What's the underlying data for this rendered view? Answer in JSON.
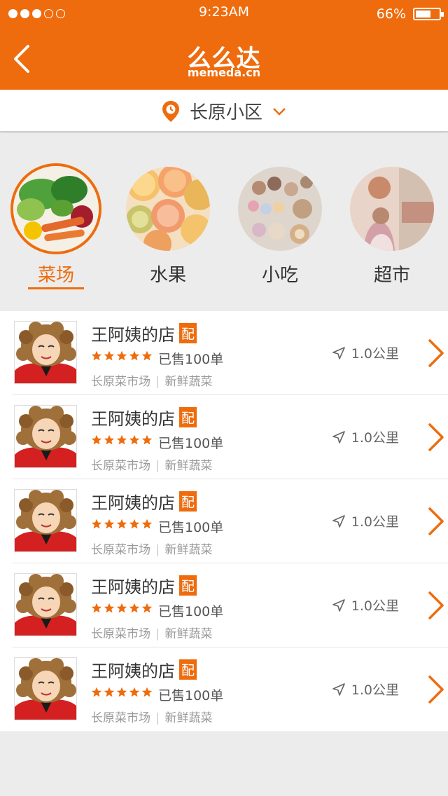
{
  "status_bar": {
    "time": "9:23AM",
    "battery": "66%",
    "battery_level": 0.66,
    "signal_dots": [
      true,
      true,
      true,
      false,
      false
    ]
  },
  "header": {
    "logo_zh": "么么达",
    "logo_en": "memeda.cn"
  },
  "location": {
    "label": "长原小区"
  },
  "colors": {
    "accent": "#ee6c0d"
  },
  "categories": [
    {
      "label": "菜场",
      "active": true
    },
    {
      "label": "水果",
      "active": false
    },
    {
      "label": "小吃",
      "active": false
    },
    {
      "label": "超市",
      "active": false
    }
  ],
  "shops": [
    {
      "name": "王阿姨的店",
      "badge": "配",
      "rating": 5,
      "sold": "已售100单",
      "market": "长原菜市场",
      "separator": "|",
      "tag": "新鲜蔬菜",
      "distance": "1.0公里"
    },
    {
      "name": "王阿姨的店",
      "badge": "配",
      "rating": 5,
      "sold": "已售100单",
      "market": "长原菜市场",
      "separator": "|",
      "tag": "新鲜蔬菜",
      "distance": "1.0公里"
    },
    {
      "name": "王阿姨的店",
      "badge": "配",
      "rating": 5,
      "sold": "已售100单",
      "market": "长原菜市场",
      "separator": "|",
      "tag": "新鲜蔬菜",
      "distance": "1.0公里"
    },
    {
      "name": "王阿姨的店",
      "badge": "配",
      "rating": 5,
      "sold": "已售100单",
      "market": "长原菜市场",
      "separator": "|",
      "tag": "新鲜蔬菜",
      "distance": "1.0公里"
    },
    {
      "name": "王阿姨的店",
      "badge": "配",
      "rating": 5,
      "sold": "已售100单",
      "market": "长原菜市场",
      "separator": "|",
      "tag": "新鲜蔬菜",
      "distance": "1.0公里"
    }
  ]
}
